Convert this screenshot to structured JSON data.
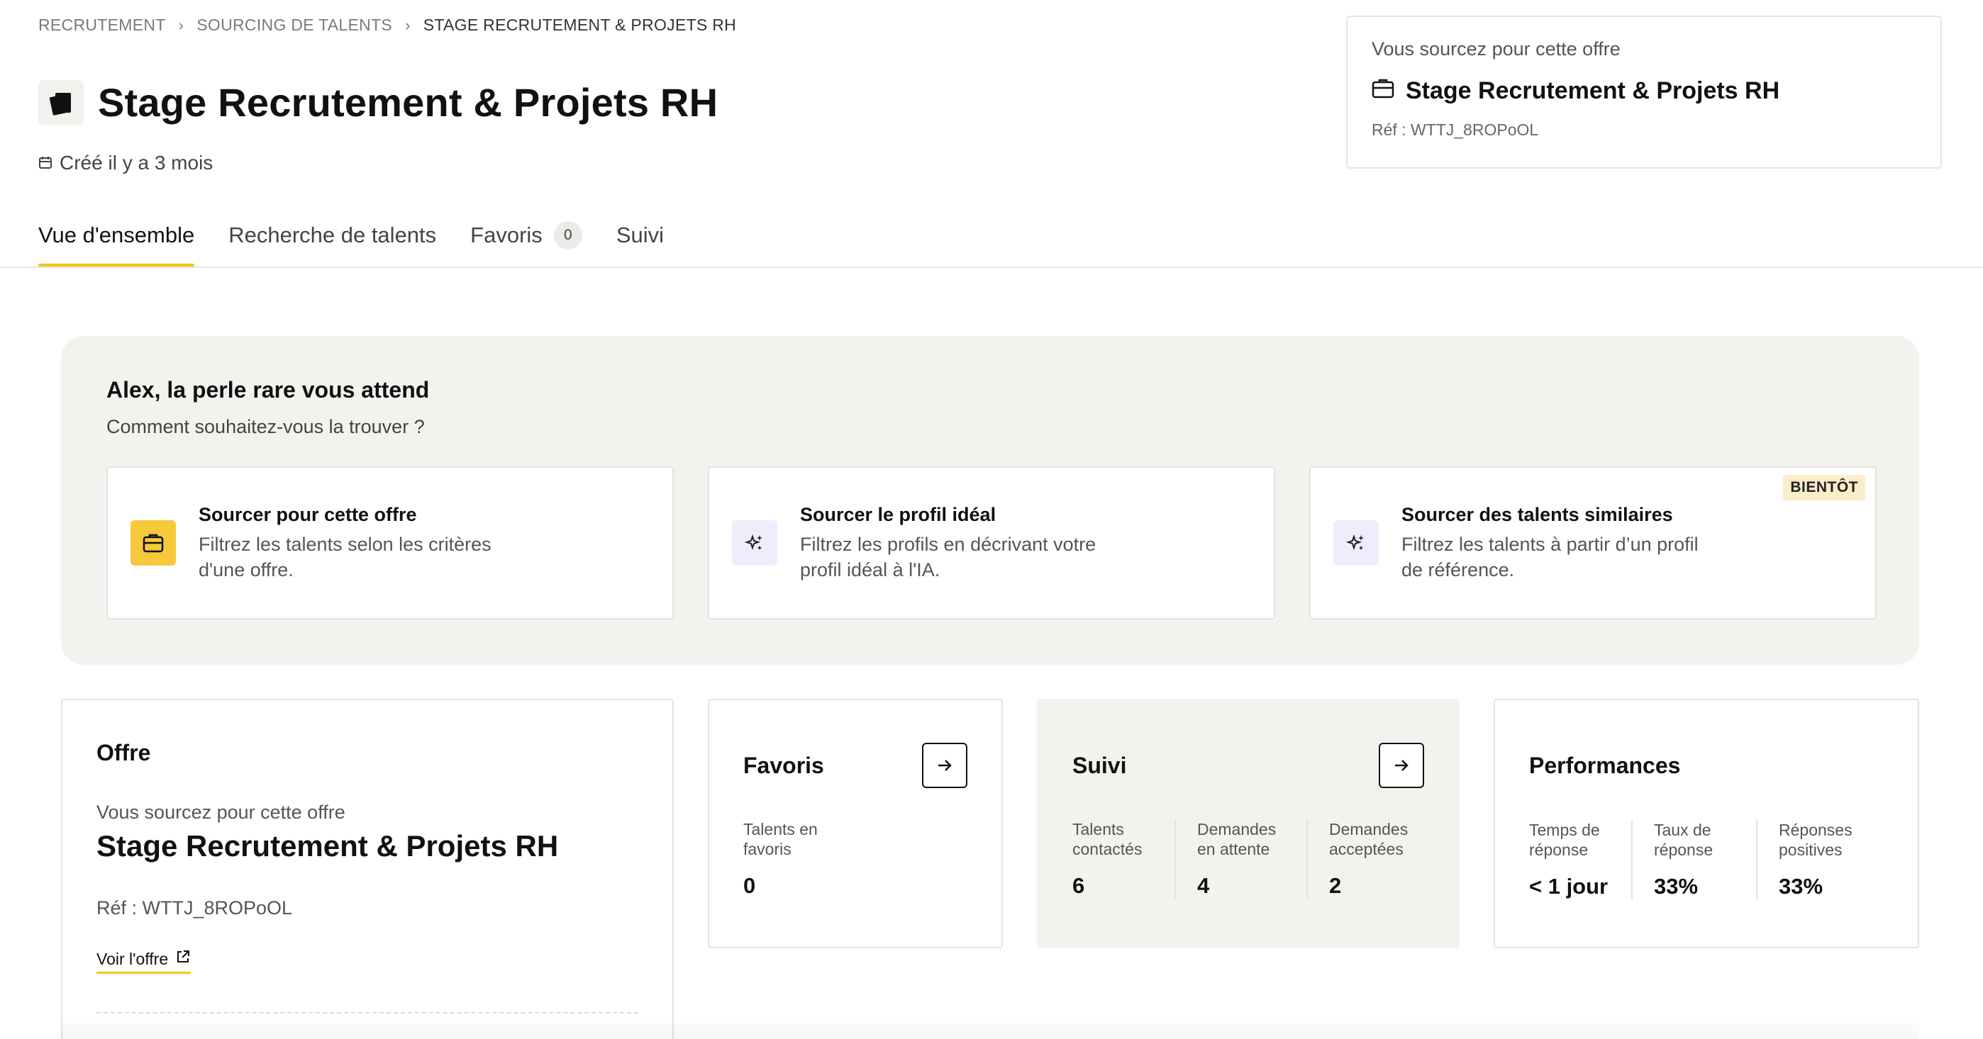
{
  "breadcrumb": {
    "items": [
      "RECRUTEMENT",
      "SOURCING DE TALENTS",
      "STAGE RECRUTEMENT & PROJETS RH"
    ]
  },
  "header": {
    "title": "Stage Recrutement & Projets RH",
    "created": "Créé il y a 3 mois"
  },
  "top_card": {
    "label": "Vous sourcez pour cette offre",
    "job": "Stage Recrutement & Projets RH",
    "ref": "Réf : WTTJ_8ROPoOL"
  },
  "tabs": [
    {
      "label": "Vue d'ensemble"
    },
    {
      "label": "Recherche de talents"
    },
    {
      "label": "Favoris",
      "count": "0"
    },
    {
      "label": "Suivi"
    }
  ],
  "hero": {
    "title": "Alex, la perle rare vous attend",
    "subtitle": "Comment souhaitez-vous la trouver ?",
    "cards": [
      {
        "title": "Sourcer pour cette offre",
        "desc": "Filtrez les talents selon les critères d'une offre."
      },
      {
        "title": "Sourcer le profil idéal",
        "desc": "Filtrez les profils en décrivant votre profil idéal à l'IA."
      },
      {
        "title": "Sourcer des talents similaires",
        "desc": "Filtrez les talents à partir d’un profil de référence.",
        "badge": "BIENTÔT"
      }
    ]
  },
  "offre": {
    "title": "Offre",
    "label": "Vous sourcez pour cette offre",
    "job": "Stage Recrutement & Projets RH",
    "ref": "Réf : WTTJ_8ROPoOL",
    "link": "Voir l'offre"
  },
  "favoris": {
    "title": "Favoris",
    "metrics": [
      {
        "label": "Talents en favoris",
        "value": "0"
      }
    ]
  },
  "suivi": {
    "title": "Suivi",
    "metrics": [
      {
        "label": "Talents contactés",
        "value": "6"
      },
      {
        "label": "Demandes en attente",
        "value": "4"
      },
      {
        "label": "Demandes acceptées",
        "value": "2"
      }
    ]
  },
  "performances": {
    "title": "Performances",
    "metrics": [
      {
        "label": "Temps de réponse",
        "value": "< 1 jour"
      },
      {
        "label": "Taux de réponse",
        "value": "33%"
      },
      {
        "label": "Réponses positives",
        "value": "33%"
      }
    ]
  },
  "colors": {
    "accent": "#f5c518",
    "panel": "#f3f2ee",
    "badge": "#fbedc9"
  },
  "icons": [
    "chevron-right-icon",
    "briefcase-icon",
    "calendar-icon",
    "sparkles-icon",
    "arrow-right-icon",
    "external-link-icon"
  ]
}
